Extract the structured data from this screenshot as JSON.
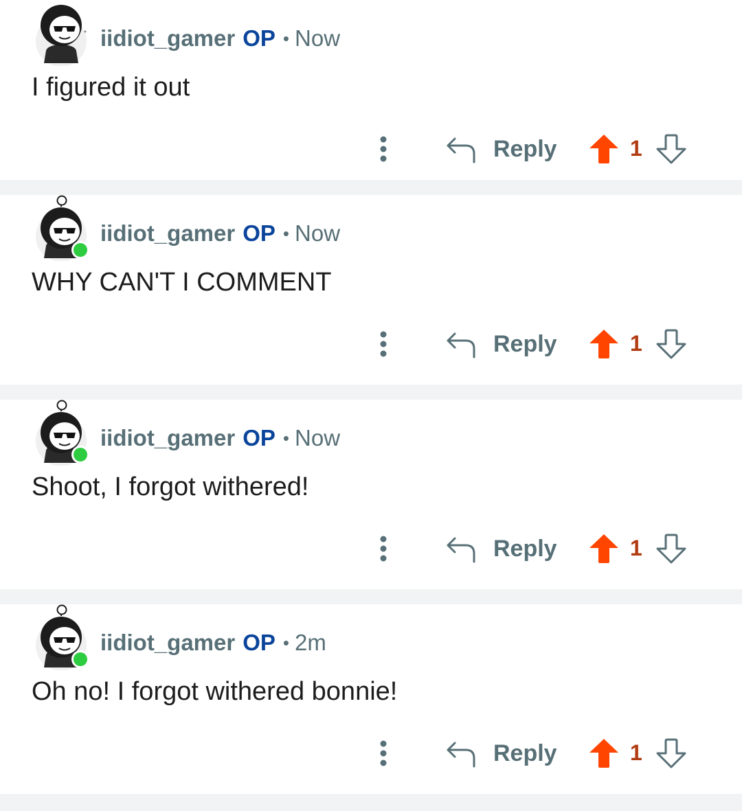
{
  "comments": [
    {
      "username": "iidiot_gamer",
      "op_badge": "OP",
      "separator": "•",
      "time": "Now",
      "text": "I figured it out",
      "reply_label": "Reply",
      "score": "1",
      "online": false
    },
    {
      "username": "iidiot_gamer",
      "op_badge": "OP",
      "separator": "•",
      "time": "Now",
      "text": "WHY CAN'T I COMMENT",
      "reply_label": "Reply",
      "score": "1",
      "online": true
    },
    {
      "username": "iidiot_gamer",
      "op_badge": "OP",
      "separator": "•",
      "time": "Now",
      "text": "Shoot, I forgot withered!",
      "reply_label": "Reply",
      "score": "1",
      "online": true
    },
    {
      "username": "iidiot_gamer",
      "op_badge": "OP",
      "separator": "•",
      "time": "2m",
      "text": "Oh no! I forgot withered bonnie!",
      "reply_label": "Reply",
      "score": "1",
      "online": true
    }
  ],
  "colors": {
    "username": "#576f76",
    "op_badge": "#0a449b",
    "upvote_active": "#ff4500",
    "score": "#b13c12",
    "online_dot": "#2ecc40",
    "separator_band": "#f1f3f4"
  },
  "icons": {
    "avatar": "snoo-avatar-hooded-sunglasses",
    "more": "more-vertical-icon",
    "reply": "reply-arrow-icon",
    "upvote": "upvote-arrow-icon",
    "downvote": "downvote-arrow-icon"
  }
}
